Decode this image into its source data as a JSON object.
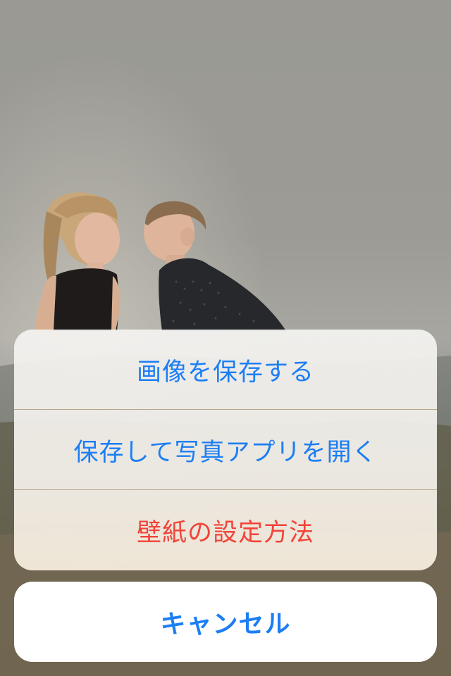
{
  "action_sheet": {
    "items": [
      {
        "label": "画像を保存する"
      },
      {
        "label": "保存して写真アプリを開く"
      },
      {
        "label": "壁紙の設定方法"
      }
    ],
    "cancel_label": "キャンセル"
  },
  "colors": {
    "action_blue": "#1c7ef4",
    "destructive_red": "#f2433a"
  },
  "background": {
    "subject": "children-kissing-photo"
  }
}
